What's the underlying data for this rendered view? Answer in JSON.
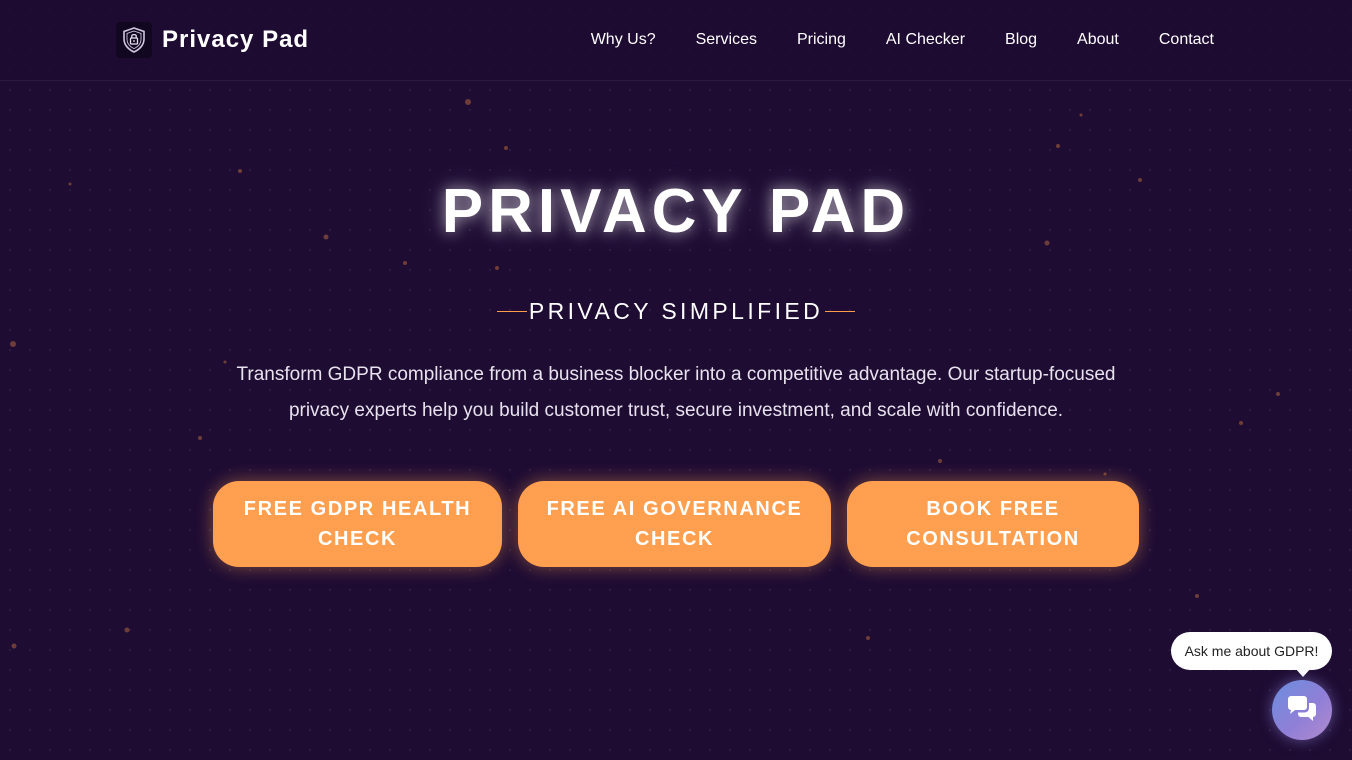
{
  "header": {
    "brand_name": "Privacy Pad",
    "nav": [
      {
        "label": "Why Us?"
      },
      {
        "label": "Services"
      },
      {
        "label": "Pricing"
      },
      {
        "label": "AI Checker"
      },
      {
        "label": "Blog"
      },
      {
        "label": "About"
      },
      {
        "label": "Contact"
      }
    ]
  },
  "hero": {
    "title": "PRIVACY PAD",
    "tagline": "PRIVACY SIMPLIFIED",
    "description": "Transform GDPR compliance from a business blocker into a competitive advantage. Our startup-focused privacy experts help you build customer trust, secure investment, and scale with confidence.",
    "cta": [
      {
        "label": "FREE GDPR HEALTH CHECK"
      },
      {
        "label": "FREE AI GOVERNANCE CHECK"
      },
      {
        "label": "BOOK FREE CONSULTATION"
      }
    ]
  },
  "chat": {
    "prompt": "Ask me about GDPR!",
    "icon": "chat-bubbles-icon"
  },
  "icons": {
    "logo": "shield-lock-icon"
  },
  "colors": {
    "background": "#1e0c33",
    "accent": "#ff9f4f",
    "text": "#ffffff"
  }
}
